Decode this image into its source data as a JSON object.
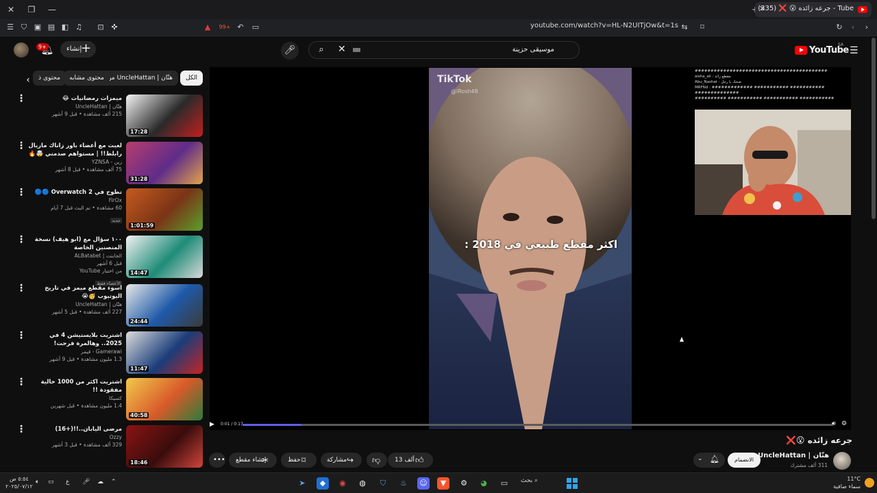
{
  "browser": {
    "tab_title": "جرعه زائده 😮 ❌ (335) - Tube",
    "url": "youtube.com/watch?v=HL-N2UITjOw&t=1s",
    "shield_count": "99+"
  },
  "header": {
    "logo_text": "YouTube",
    "country_code": "SA",
    "search_value": "موسيقى حزينة",
    "create_label": "إنشاء",
    "notif_badge": "9+"
  },
  "chips": [
    {
      "label": "الكل",
      "active": true
    },
    {
      "label": "من UncleHattan | هتّان",
      "active": false
    },
    {
      "label": "محتوى مشابه",
      "active": false
    },
    {
      "label": "محتوى ذ",
      "active": false
    }
  ],
  "recommendations": [
    {
      "title": "ميمزات رمضانيات 😂",
      "channel": "هتّان | UncleHattan",
      "stats": "215 ألف مشاهدة • قبل 9 أشهر",
      "duration": "17:28",
      "colors": [
        "#f4f4f4",
        "#2a2a2a",
        "#c41f1f"
      ]
    },
    {
      "title": "لعبت مع أعضاء باور زاناك ماريال رابلظ!! | مستواهم صدمني 🤯🔥",
      "channel": "زين - YZNSA",
      "stats": "75 ألف مشاهدة • قبل 8 أشهر",
      "duration": "31:28",
      "colors": [
        "#b73d6e",
        "#5f2c8a",
        "#e3a44a"
      ]
    },
    {
      "title": "تطوح في Overwatch 2 🔵🔵",
      "channel": "FirOx",
      "stats": "60 مشاهدة • تم البث قبل 7 أيام",
      "badge": "جديد",
      "duration": "1:01:59",
      "colors": [
        "#c65a1f",
        "#7a3416",
        "#5aa02c"
      ]
    },
    {
      "title": "١٠٠ سؤال مع (ابو هيف) نسخة المتصنين الخاصة",
      "channel": "الجابتت | ALBatabet",
      "stats": "قبل 6 أشهر",
      "extra": "من اختيار YouTube",
      "badge": "الأعضاء فقط",
      "duration": "14:47",
      "colors": [
        "#f2f2f2",
        "#1e8c78",
        "#d9d9d9"
      ]
    },
    {
      "title": "اسوء مقطع ميمز في تاريخ اليوتيوب 🥳😭",
      "channel": "هتّان | UncleHattan",
      "stats": "227 ألف مشاهدة • قبل 5 أشهر",
      "duration": "24:44",
      "colors": [
        "#e8e8e8",
        "#1e5aa8",
        "#3b3b3b"
      ]
    },
    {
      "title": "اشتريت بلايستيشن 4 في 2025.. وهالمرة فرحت!",
      "channel": "Gamerawi - قيمر",
      "stats": "1.3 مليون مشاهدة • قبل 9 أشهر",
      "duration": "11:47",
      "colors": [
        "#dcdcdc",
        "#1a3d7a",
        "#c42424"
      ]
    },
    {
      "title": "اشتريت اكثر من 1000 حالية مفقودة !!",
      "channel": "كسيكا",
      "stats": "1.4 مليون مشاهدة • قبل شهرين",
      "duration": "40:58",
      "colors": [
        "#f2c94c",
        "#d85a2a",
        "#2d7c3a"
      ]
    },
    {
      "title": "مرضى اليابان..!!(+16)",
      "channel": "Ozzy",
      "stats": "329 ألف مشاهدة • قبل 3 أشهر",
      "duration": "18:46",
      "colors": [
        "#8a1414",
        "#3a0c0c",
        "#d1453b"
      ]
    }
  ],
  "player": {
    "time": "0:01 / 0:17",
    "progress": 0.1,
    "caption": "اكثر مقطع طبيعي في 2018 :",
    "watermark": "TikTok",
    "watermark_user": "@iRosh48",
    "chat_lines": [
      "##########################################",
      "aisha_ali : مقطع زائد",
      "Abu_Nashat : ضحك يا رجل",
      "MRFNd : ############# ########### ########### ##############",
      "########## ########### ########### ###########"
    ]
  },
  "video": {
    "title": "جرعه زائده 😮❌",
    "channel_name": "هتّان | UncleHattan",
    "subscribers": "311 ألف مشترك",
    "join_label": "الانضمام",
    "likes": "13 ألف",
    "share_label": "مشاركة",
    "save_label": "حفظ",
    "clip_label": "إنشاء مقطع"
  },
  "taskbar": {
    "search_label": "بحث",
    "temperature": "11°C",
    "weather_text": "سماء صافية",
    "time": "٥:٥٤ ص",
    "date": "٢٠٢٥/٠٧/١٢",
    "lang": "ع"
  },
  "colors": {
    "accent": "#ff0000",
    "progress": "#5f5fe8",
    "bg": "#0f0f0f"
  }
}
